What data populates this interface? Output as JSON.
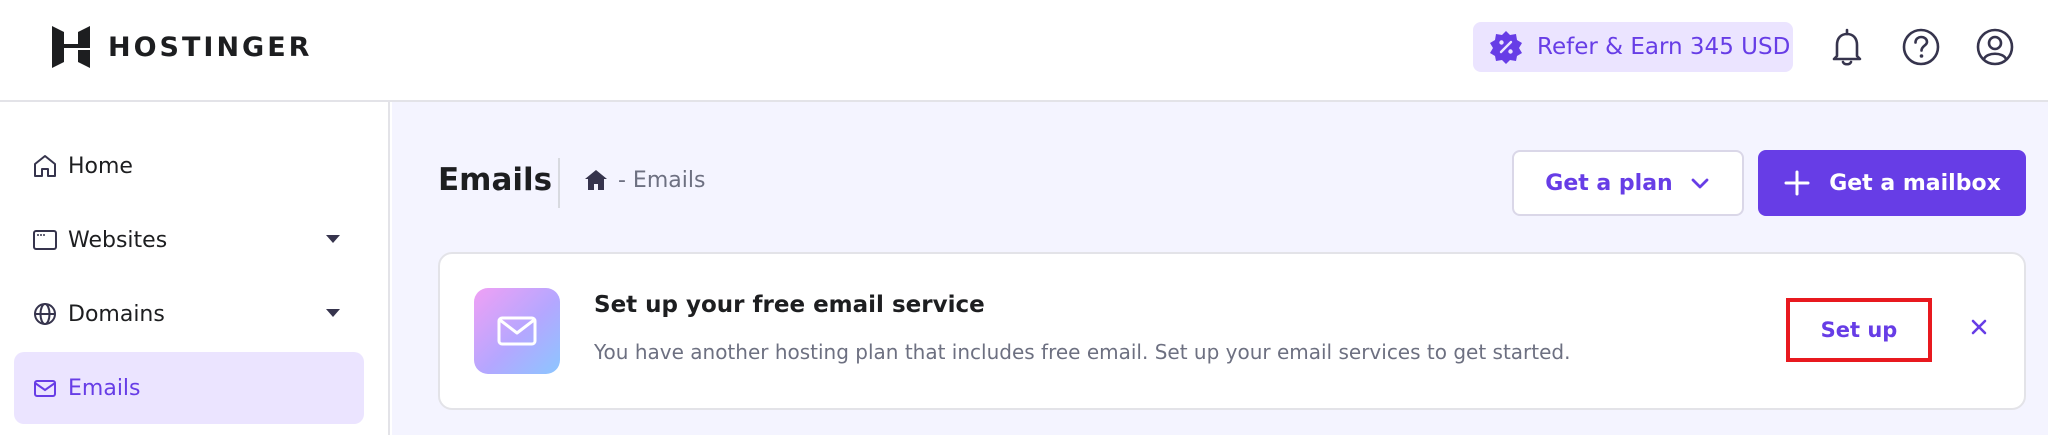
{
  "header": {
    "brand": "HOSTINGER",
    "refer_label": "Refer & Earn 345 USD",
    "icons": [
      "bell-icon",
      "help-icon",
      "account-icon"
    ]
  },
  "sidebar": {
    "items": [
      {
        "label": "Home",
        "icon": "home-icon",
        "has_caret": false,
        "active": false
      },
      {
        "label": "Websites",
        "icon": "browser-icon",
        "has_caret": true,
        "active": false
      },
      {
        "label": "Domains",
        "icon": "globe-icon",
        "has_caret": true,
        "active": false
      },
      {
        "label": "Emails",
        "icon": "mail-icon",
        "has_caret": false,
        "active": true
      }
    ]
  },
  "main": {
    "title": "Emails",
    "breadcrumb": "- Emails",
    "plan_button": "Get a plan",
    "mailbox_button": "Get a mailbox"
  },
  "banner": {
    "title": "Set up your free email service",
    "description": "You have another hosting plan that includes free email. Set up your email services to get started.",
    "action": "Set up"
  },
  "colors": {
    "accent": "#673de6",
    "accent_light": "#ebe4ff",
    "page_bg": "#f4f4ff",
    "highlight_border": "#e8191f"
  }
}
